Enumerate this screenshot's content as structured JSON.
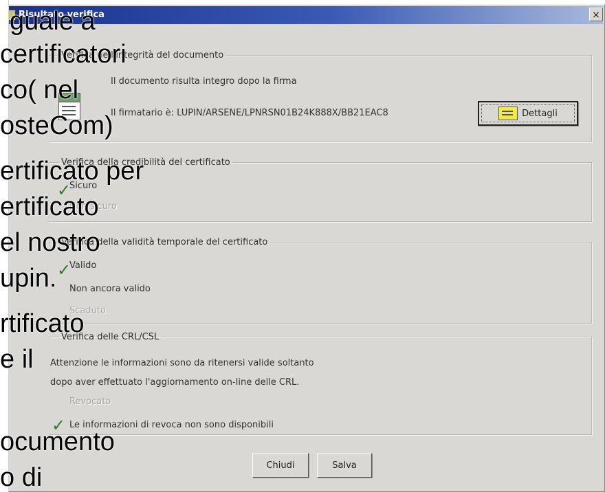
{
  "window": {
    "title": "Risultato verifica",
    "close_label": "×"
  },
  "integrity_group": {
    "legend": "Verifica dell'integrità del documento",
    "line1": "Il documento risulta integro dopo la firma",
    "line2": "Il firmatario è: LUPIN/ARSENE/LPNRSN01B24K888X/BB21EAC8",
    "details_button": "Dettagli"
  },
  "credibility_group": {
    "legend": "Verifica della credibilità del certificato",
    "item1": "Sicuro",
    "item2": "Non sicuro"
  },
  "validity_group": {
    "legend": "Verifica della validità temporale del certificato",
    "item1": "Valido",
    "item2": "Non ancora valido",
    "item3": "Scaduto"
  },
  "crl_group": {
    "legend": "Verifica delle CRL/CSL",
    "note1": "Attenzione le informazioni sono da ritenersi valide soltanto",
    "note2": "dopo aver effettuato l'aggiornamento on-line delle CRL.",
    "item1": "Revocato",
    "item2": "Le informazioni di revoca non sono disponibili"
  },
  "buttons": {
    "close": "Chiudi",
    "save": "Salva"
  },
  "slide_overlay": {
    "lines": [
      "guale a",
      "certificatori",
      "co( nel",
      "osteCom)",
      "ertificato per",
      "ertificato",
      "el nostro",
      "upin.",
      "rtificato",
      "e il",
      "ocumento",
      "o di"
    ]
  },
  "colors": {
    "titlebar_start": "#18308c",
    "dialog_bg": "#d9d8d5",
    "check_green": "#2f7a2f"
  }
}
